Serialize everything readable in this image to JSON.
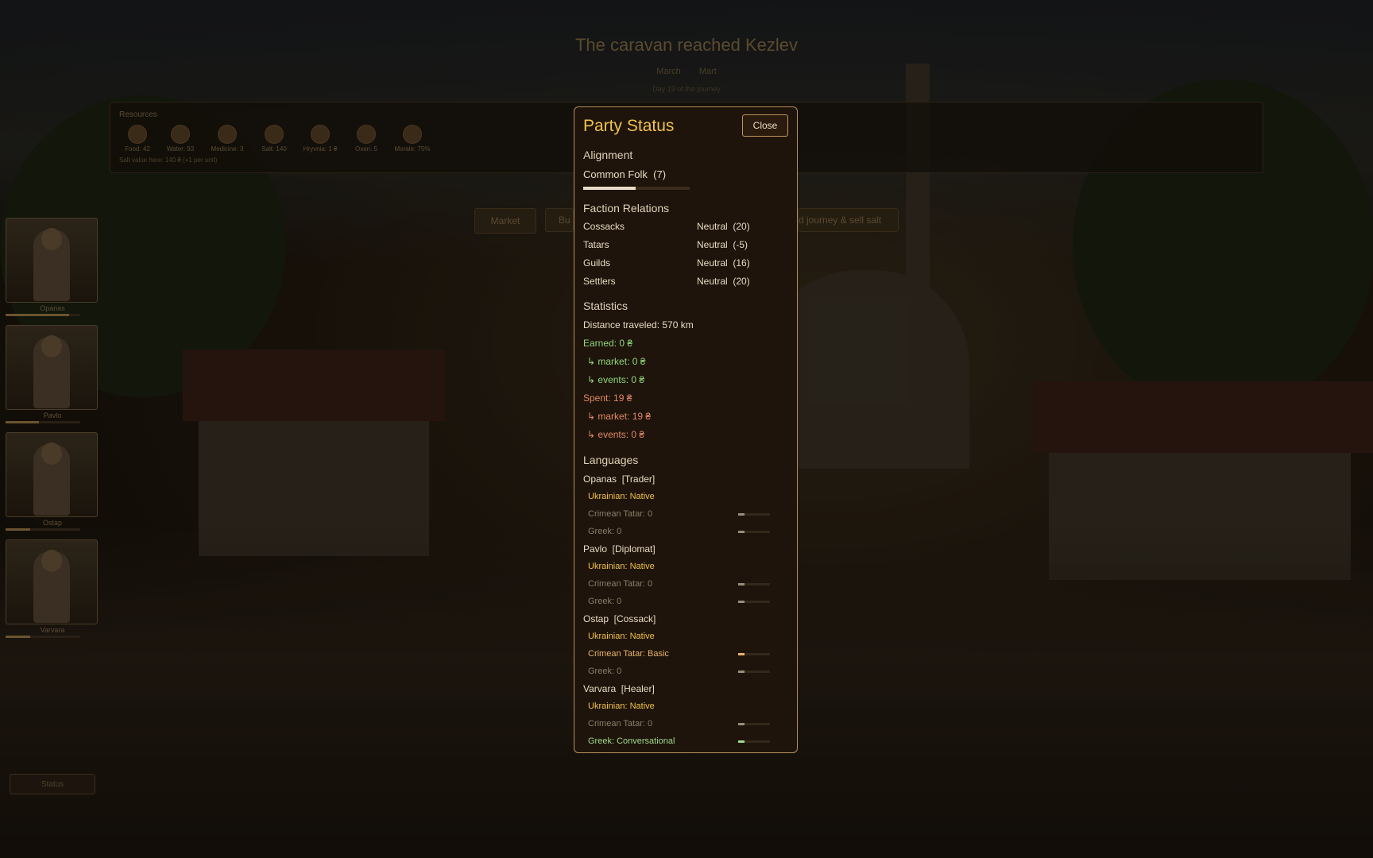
{
  "header": {
    "title": "The caravan reached Kezlev",
    "subs": [
      "March",
      "Mart"
    ],
    "day": "Day 19 of the journey"
  },
  "resources": {
    "title": "Resources",
    "items": [
      {
        "icon": "food-icon",
        "label": "Food: 42"
      },
      {
        "icon": "water-icon",
        "label": "Water: 93"
      },
      {
        "icon": "medicine-icon",
        "label": "Medicine: 3"
      },
      {
        "icon": "salt-icon",
        "label": "Salt: 140"
      },
      {
        "icon": "hryvnia-icon",
        "label": "Hryvnia: 1 ₴"
      },
      {
        "icon": "oxen-icon",
        "label": "Oxen: 5"
      },
      {
        "icon": "morale-icon",
        "label": "Morale: 75%"
      }
    ],
    "note": "Salt value here: 140 ₴ (+1 per unit)"
  },
  "actions": [
    "Market",
    "Bu",
    "d journey & sell salt"
  ],
  "party": [
    {
      "name": "Opanas",
      "health": 0.85
    },
    {
      "name": "Pavlo",
      "health": 0.45
    },
    {
      "name": "Ostap",
      "health": 0.33
    },
    {
      "name": "Varvara",
      "health": 0.33
    }
  ],
  "status_button": "Status",
  "modal": {
    "title": "Party Status",
    "close": "Close",
    "alignment": {
      "heading": "Alignment",
      "label": "Common Folk  (7)",
      "level": 0.49
    },
    "factions": {
      "heading": "Faction Relations",
      "rows": [
        {
          "name": "Cossacks",
          "value": "Neutral  (20)"
        },
        {
          "name": "Tatars",
          "value": "Neutral  (-5)"
        },
        {
          "name": "Guilds",
          "value": "Neutral  (16)"
        },
        {
          "name": "Settlers",
          "value": "Neutral  (20)"
        }
      ]
    },
    "statistics": {
      "heading": "Statistics",
      "distance": "Distance traveled: 570 km",
      "earned": "Earned: 0 ₴",
      "earned_market": "↳ market: 0 ₴",
      "earned_events": "↳ events: 0 ₴",
      "spent": "Spent: 19 ₴",
      "spent_market": "↳ market: 19 ₴",
      "spent_events": "↳ events: 0 ₴"
    },
    "languages": {
      "heading": "Languages",
      "members": [
        {
          "head": "Opanas  [Trader]",
          "langs": [
            {
              "text": "Ukrainian: Native",
              "level": "native"
            },
            {
              "text": "Crimean Tatar: 0",
              "level": "none",
              "bar": 0.2
            },
            {
              "text": "Greek: 0",
              "level": "none",
              "bar": 0.2
            }
          ]
        },
        {
          "head": "Pavlo  [Diplomat]",
          "langs": [
            {
              "text": "Ukrainian: Native",
              "level": "native"
            },
            {
              "text": "Crimean Tatar: 0",
              "level": "none",
              "bar": 0.2
            },
            {
              "text": "Greek: 0",
              "level": "none",
              "bar": 0.2
            }
          ]
        },
        {
          "head": "Ostap  [Cossack]",
          "langs": [
            {
              "text": "Ukrainian: Native",
              "level": "native"
            },
            {
              "text": "Crimean Tatar: Basic",
              "level": "basic",
              "bar": 0.2
            },
            {
              "text": "Greek: 0",
              "level": "none",
              "bar": 0.2
            }
          ]
        },
        {
          "head": "Varvara  [Healer]",
          "langs": [
            {
              "text": "Ukrainian: Native",
              "level": "native"
            },
            {
              "text": "Crimean Tatar: 0",
              "level": "none",
              "bar": 0.2
            },
            {
              "text": "Greek: Conversational",
              "level": "conv",
              "bar": 0.2
            }
          ]
        }
      ]
    }
  },
  "colors": {
    "accent": "#f1c24a",
    "earned": "#8fd67a",
    "spent": "#e08866",
    "border": "#b58f5a"
  }
}
